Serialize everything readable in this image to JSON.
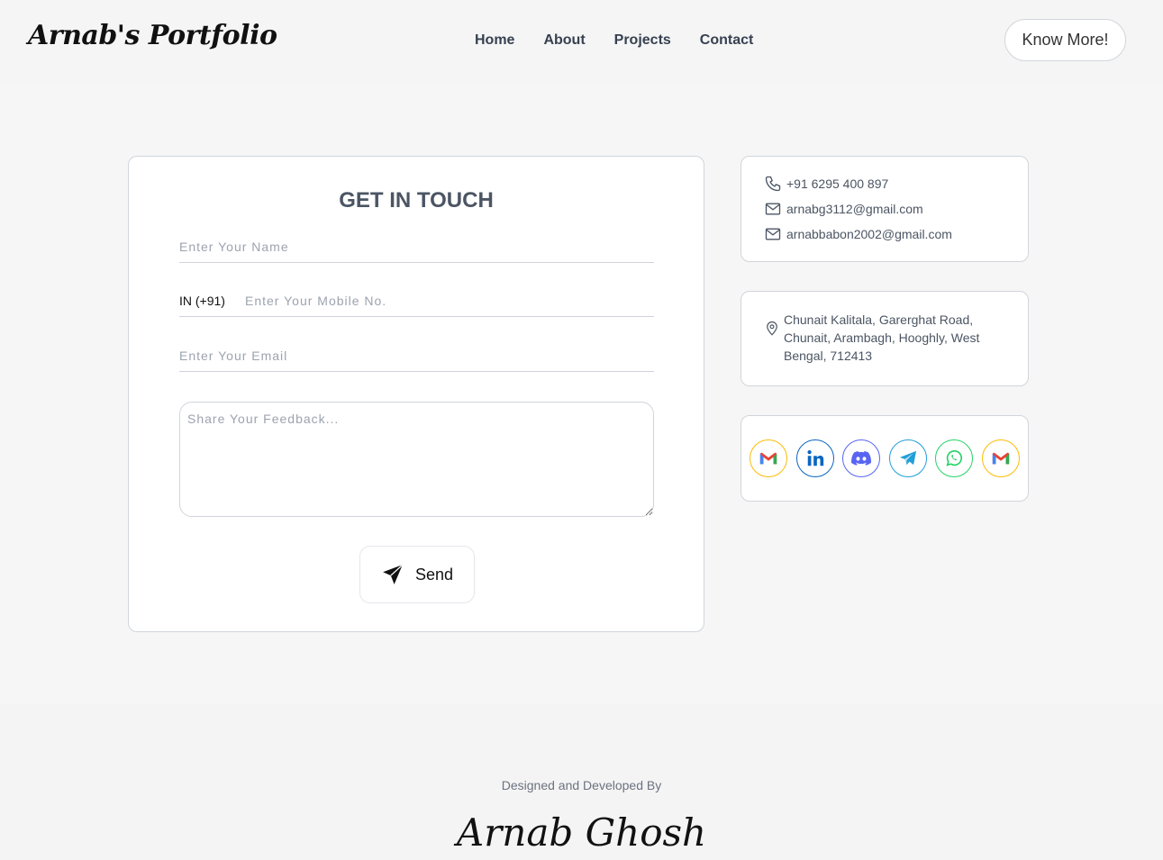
{
  "header": {
    "logo": "Arnab's Portfolio",
    "nav": [
      "Home",
      "About",
      "Projects",
      "Contact"
    ],
    "cta": "Know More!"
  },
  "form": {
    "title": "GET IN TOUCH",
    "name_placeholder": "Enter Your Name",
    "country_code": "IN (+91)",
    "mobile_placeholder": "Enter Your Mobile No.",
    "email_placeholder": "Enter Your Email",
    "feedback_placeholder": "Share Your Feedback...",
    "send_label": "Send"
  },
  "contact": {
    "phone": "+91 6295 400 897",
    "email1": "arnabg3112@gmail.com",
    "email2": "arnabbabon2002@gmail.com"
  },
  "address": "Chunait Kalitala, Garerghat Road, Chunait, Arambagh, Hooghly, West Bengal, 712413",
  "socials": [
    {
      "icon": "gmail-icon",
      "color": "#ea4335"
    },
    {
      "icon": "linkedin-icon",
      "color": "#0a66c2"
    },
    {
      "icon": "discord-icon",
      "color": "#5865f2"
    },
    {
      "icon": "telegram-icon",
      "color": "#229ed9"
    },
    {
      "icon": "whatsapp-icon",
      "color": "#25d366"
    },
    {
      "icon": "gmail-icon",
      "color": "#ea4335"
    }
  ],
  "footer": {
    "caption": "Designed and Developed By",
    "name": "Arnab Ghosh"
  }
}
